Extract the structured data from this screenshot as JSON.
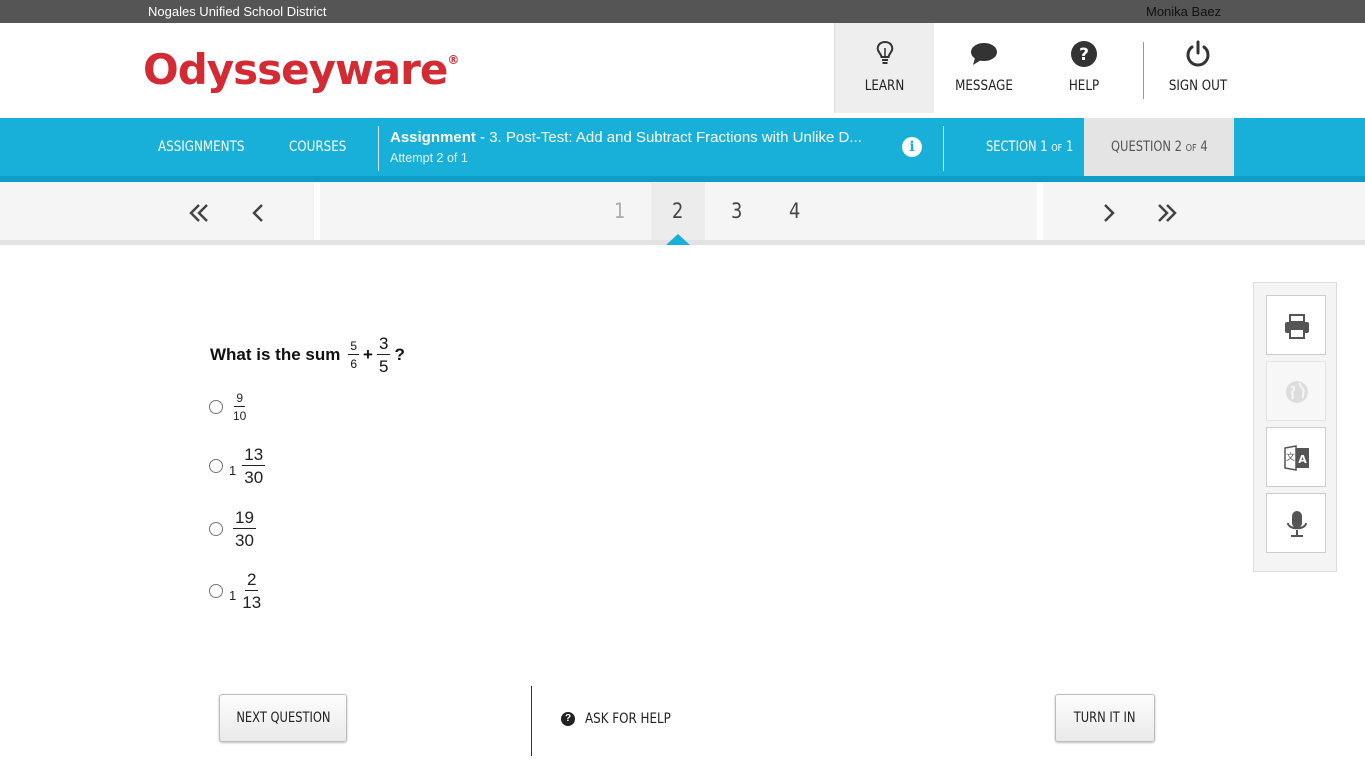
{
  "topbar": {
    "district": "Nogales Unified School District",
    "user": "Monika Baez"
  },
  "header": {
    "logo": "Odysseyware",
    "logo_mark": "®",
    "nav": {
      "learn": "LEARN",
      "message": "MESSAGE",
      "help": "HELP",
      "signout": "SIGN OUT"
    }
  },
  "bluebar": {
    "assignments": "ASSIGNMENTS",
    "courses": "COURSES",
    "assignment_label": "Assignment",
    "assignment_title": " - 3. Post-Test: Add and Subtract Fractions with Unlike D...",
    "attempt": "Attempt 2 of 1",
    "info_icon": "i",
    "section": {
      "word": "SECTION 1 ",
      "of": "OF",
      "total": " 1"
    },
    "question": {
      "word": "QUESTION 2 ",
      "of": "OF",
      "total": " 4"
    }
  },
  "pager": {
    "pages": [
      "1",
      "2",
      "3",
      "4"
    ],
    "current": 2
  },
  "question": {
    "prefix": "What is the sum",
    "f1": {
      "num": "5",
      "den": "6"
    },
    "op": "+",
    "f2": {
      "num": "3",
      "den": "5"
    },
    "suffix": "?",
    "options": [
      {
        "whole": "",
        "num": "9",
        "den": "10"
      },
      {
        "whole": "1",
        "num": "13",
        "den": "30"
      },
      {
        "whole": "",
        "num": "19",
        "den": "30"
      },
      {
        "whole": "1",
        "num": "2",
        "den": "13"
      }
    ]
  },
  "tools": [
    "printer-icon",
    "globe-icon",
    "translate-icon",
    "microphone-icon"
  ],
  "footer": {
    "next": "NEXT QUESTION",
    "ask": "ASK FOR HELP",
    "ask_icon": "?",
    "turnin": "TURN IT IN"
  }
}
